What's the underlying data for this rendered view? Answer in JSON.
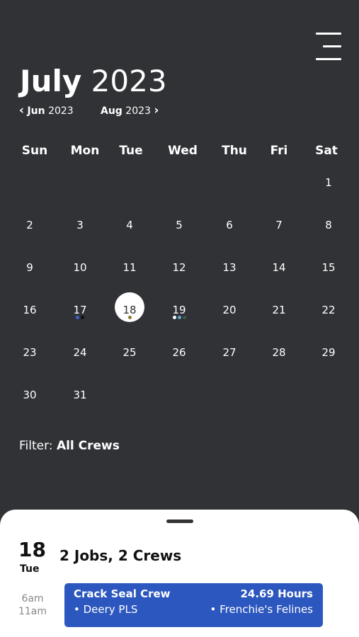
{
  "header": {
    "month": "July",
    "year": "2023",
    "prev_month": "Jun",
    "prev_year": "2023",
    "next_month": "Aug",
    "next_year": "2023",
    "prev_chevron": "‹",
    "next_chevron": "›"
  },
  "weekdays": [
    "Sun",
    "Mon",
    "Tue",
    "Wed",
    "Thu",
    "Fri",
    "Sat"
  ],
  "days": [
    "1",
    "2",
    "3",
    "4",
    "5",
    "6",
    "7",
    "8",
    "9",
    "10",
    "11",
    "12",
    "13",
    "14",
    "15",
    "16",
    "17",
    "18",
    "19",
    "20",
    "21",
    "22",
    "23",
    "24",
    "25",
    "26",
    "27",
    "28",
    "29",
    "30",
    "31"
  ],
  "first_weekday": 6,
  "selected_day": "18",
  "event_dots": {
    "17": [
      "#3b63c9",
      "#111111"
    ],
    "18": [
      "#8a7a2a"
    ],
    "19": [
      "#ffffff",
      "#5fa6d6",
      "#3b5a45"
    ]
  },
  "filter": {
    "label": "Filter:",
    "value": "All Crews"
  },
  "sheet": {
    "day": "18",
    "weekday": "Tue",
    "summary": "2 Jobs, 2 Crews",
    "start_time": "6am",
    "end_time": "11am",
    "job": {
      "crew": "Crack Seal Crew",
      "hours": "24.69 Hours",
      "customer1": "• Deery PLS",
      "customer2": "• Frenchie's Felines",
      "color": "#2c57bf"
    }
  },
  "icons": {
    "menu": "hamburger-menu-icon"
  }
}
